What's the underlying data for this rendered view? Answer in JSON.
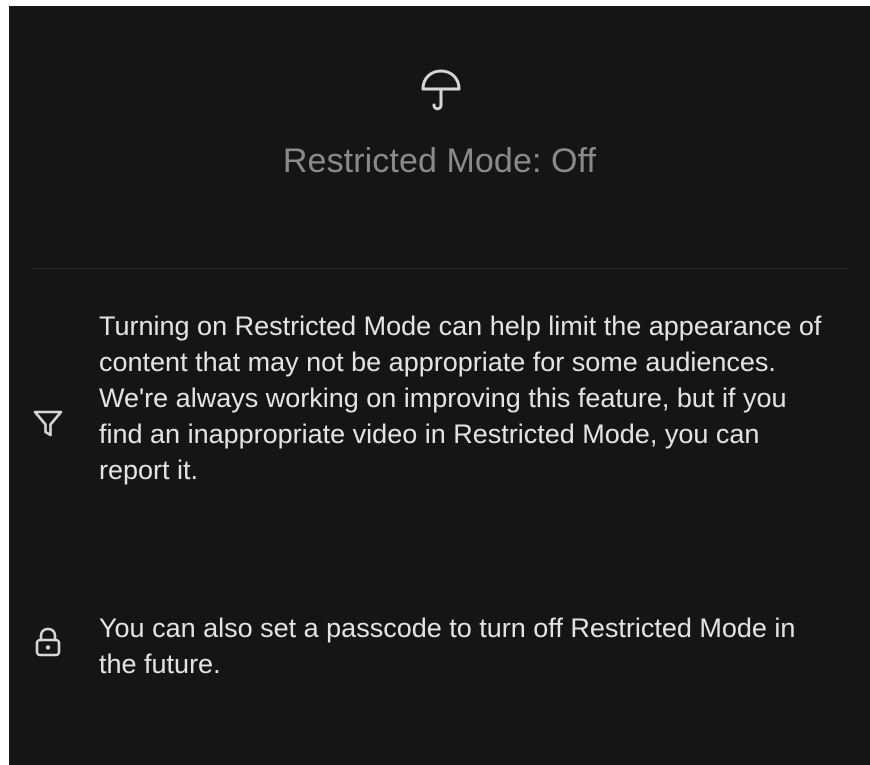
{
  "header": {
    "icon": "umbrella-icon",
    "title": "Restricted Mode: Off"
  },
  "info_rows": [
    {
      "icon": "filter-icon",
      "text": "Turning on Restricted Mode can help limit the appearance of content that may not be appropriate for some audiences. We're always working on improving this feature, but if you find an inappropriate video in Restricted Mode, you can report it."
    },
    {
      "icon": "lock-icon",
      "text": "You can also set a passcode to turn off Restricted Mode in the future."
    }
  ],
  "colors": {
    "background": "#151515",
    "title": "#8a8a8a",
    "body_text": "#e3e3e3",
    "icon": "#d6d6d6",
    "divider": "#2c2c2c"
  }
}
